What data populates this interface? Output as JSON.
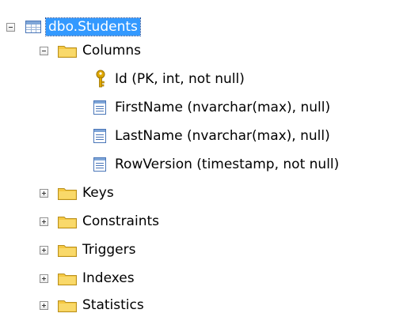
{
  "tree": {
    "table": {
      "label": "dbo.Students",
      "icon": "table-icon",
      "expander": "collapse-icon",
      "selected": true
    },
    "columns_folder": {
      "label": "Columns",
      "icon": "folder-icon",
      "expander": "collapse-icon"
    },
    "columns": [
      {
        "label": "Id (PK, int, not null)",
        "icon": "key-icon"
      },
      {
        "label": "FirstName (nvarchar(max), null)",
        "icon": "column-icon"
      },
      {
        "label": "LastName (nvarchar(max), null)",
        "icon": "column-icon"
      },
      {
        "label": "RowVersion (timestamp, not null)",
        "icon": "column-icon"
      }
    ],
    "folders": [
      {
        "label": "Keys",
        "icon": "folder-icon",
        "expander": "expand-icon"
      },
      {
        "label": "Constraints",
        "icon": "folder-icon",
        "expander": "expand-icon"
      },
      {
        "label": "Triggers",
        "icon": "folder-icon",
        "expander": "expand-icon"
      },
      {
        "label": "Indexes",
        "icon": "folder-icon",
        "expander": "expand-icon"
      },
      {
        "label": "Statistics",
        "icon": "folder-icon",
        "expander": "expand-icon"
      }
    ],
    "colors": {
      "selection": "#3399ff",
      "folder": "#f5c842",
      "key": "#e0a800",
      "column_icon": "#4a76b8"
    }
  }
}
